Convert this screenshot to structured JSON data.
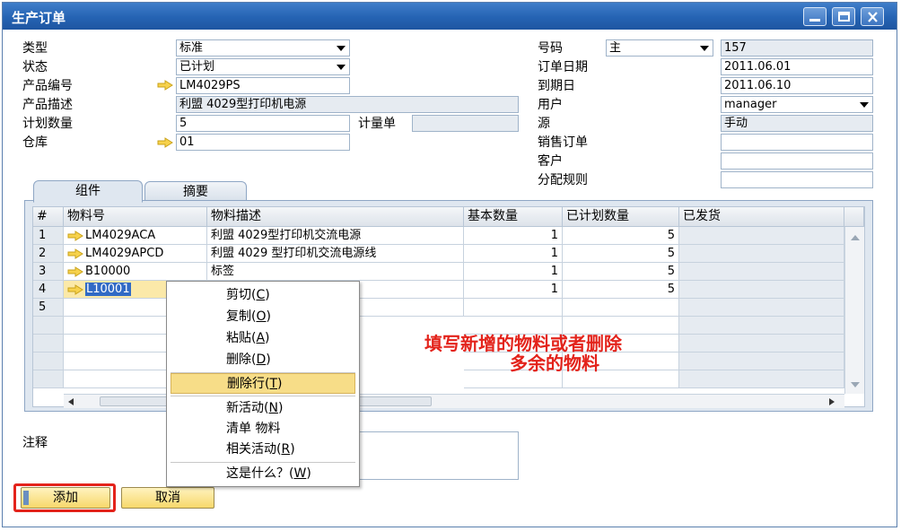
{
  "window": {
    "title": "生产订单",
    "min_icon": "minimize-icon",
    "max_icon": "maximize-icon",
    "close_icon": "close-icon"
  },
  "header_left": {
    "type_label": "类型",
    "type_value": "标准",
    "status_label": "状态",
    "status_value": "已计划",
    "product_no_label": "产品编号",
    "product_no_value": "LM4029PS",
    "product_desc_label": "产品描述",
    "product_desc_value": "利盟 4029型打印机电源",
    "planned_qty_label": "计划数量",
    "planned_qty_value": "5",
    "uom_label": "计量单",
    "uom_value": "",
    "warehouse_label": "仓库",
    "warehouse_value": "01"
  },
  "header_right": {
    "number_label": "号码",
    "series_value": "主",
    "number_value": "157",
    "order_date_label": "订单日期",
    "order_date_value": "2011.06.01",
    "due_date_label": "到期日",
    "due_date_value": "2011.06.10",
    "user_label": "用户",
    "user_value": "manager",
    "source_label": "源",
    "source_value": "手动",
    "sales_order_label": "销售订单",
    "sales_order_value": "",
    "customer_label": "客户",
    "customer_value": "",
    "distribution_rule_label": "分配规则",
    "distribution_rule_value": ""
  },
  "tabs": [
    {
      "label": "组件",
      "active": true
    },
    {
      "label": "摘要",
      "active": false
    }
  ],
  "grid": {
    "columns": [
      "#",
      "物料号",
      "物料描述",
      "基本数量",
      "已计划数量",
      "已发货"
    ],
    "rows": [
      {
        "num": "1",
        "item": "LM4029ACA",
        "desc": "利盟 4029型打印机交流电源",
        "base_qty": "1",
        "planned_qty": "5",
        "issued": ""
      },
      {
        "num": "2",
        "item": "LM4029APCD",
        "desc": "利盟 4029 型打印机交流电源线",
        "base_qty": "1",
        "planned_qty": "5",
        "issued": ""
      },
      {
        "num": "3",
        "item": "B10000",
        "desc": "标签",
        "base_qty": "1",
        "planned_qty": "5",
        "issued": ""
      },
      {
        "num": "4",
        "item": "L10001",
        "desc": "",
        "base_qty": "1",
        "planned_qty": "5",
        "issued": ""
      },
      {
        "num": "5",
        "item": "",
        "desc": "",
        "base_qty": "",
        "planned_qty": "",
        "issued": ""
      }
    ]
  },
  "context_menu": {
    "items": [
      {
        "label": "剪切",
        "key": "C"
      },
      {
        "label": "复制",
        "key": "O"
      },
      {
        "label": "粘贴",
        "key": "A"
      },
      {
        "label": "删除",
        "key": "D"
      },
      {
        "label": "删除行",
        "key": "T",
        "highlighted": true
      },
      {
        "label": "新活动",
        "key": "N"
      },
      {
        "label": "清单 物料",
        "key": ""
      },
      {
        "label": "相关活动",
        "key": "R"
      },
      {
        "label": "这是什么？",
        "key": "W"
      }
    ]
  },
  "annotation": {
    "line1": "填写新增的物料或者删除",
    "line2": "多余的物料",
    "color": "#e3231b"
  },
  "remarks": {
    "label": "注释",
    "value": ""
  },
  "buttons": {
    "add_label": "添加",
    "cancel_label": "取消"
  },
  "colors": {
    "titlebar": "#2563b3",
    "highlight": "#f7dd88",
    "button": "#f7d86b",
    "callout_box": "#e3231b"
  }
}
